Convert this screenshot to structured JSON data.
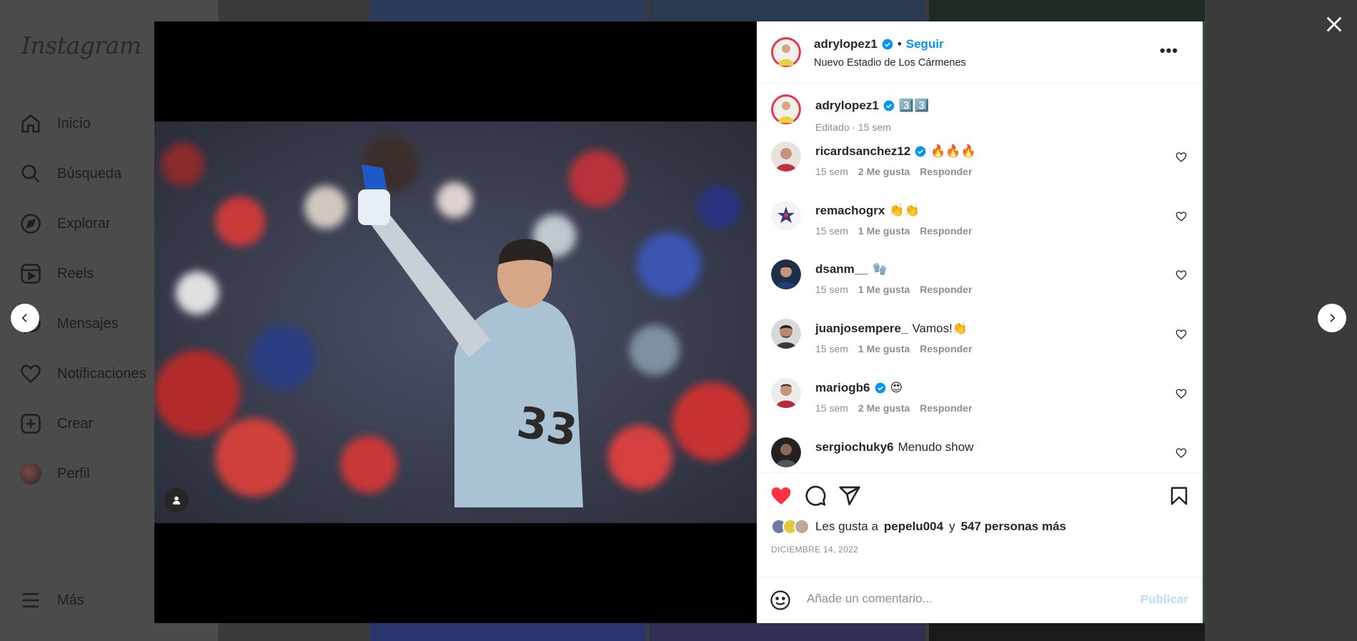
{
  "sidebar": {
    "logo": "Instagram",
    "items": [
      {
        "label": "Inicio",
        "icon": "home-icon"
      },
      {
        "label": "Búsqueda",
        "icon": "search-icon"
      },
      {
        "label": "Explorar",
        "icon": "compass-icon"
      },
      {
        "label": "Reels",
        "icon": "reels-icon"
      },
      {
        "label": "Mensajes",
        "icon": "messenger-icon"
      },
      {
        "label": "Notificaciones",
        "icon": "heart-icon"
      },
      {
        "label": "Crear",
        "icon": "plus-square-icon"
      },
      {
        "label": "Perfil",
        "icon": "profile-avatar"
      }
    ],
    "more": "Más"
  },
  "post": {
    "header": {
      "username": "adrylopez1",
      "separator": "•",
      "follow": "Seguir",
      "location": "Nuevo Estadio de Los Cármenes"
    },
    "caption": {
      "username": "adrylopez1",
      "text": "3️⃣3️⃣",
      "meta": "Editado · 15 sem"
    },
    "comments": [
      {
        "username": "ricardsanchez12",
        "verified": true,
        "text": "🔥🔥🔥",
        "time": "15 sem",
        "likes": "2 Me gusta",
        "reply": "Responder"
      },
      {
        "username": "remachogrx",
        "verified": false,
        "text": "👏👏",
        "time": "15 sem",
        "likes": "1 Me gusta",
        "reply": "Responder"
      },
      {
        "username": "dsanm__",
        "verified": false,
        "text": "🧤",
        "time": "15 sem",
        "likes": "1 Me gusta",
        "reply": "Responder"
      },
      {
        "username": "juanjosempere_",
        "verified": false,
        "text": "Vamos!👏",
        "time": "15 sem",
        "likes": "1 Me gusta",
        "reply": "Responder"
      },
      {
        "username": "mariogb6",
        "verified": true,
        "text": "😍",
        "time": "15 sem",
        "likes": "2 Me gusta",
        "reply": "Responder"
      },
      {
        "username": "sergiochuky6",
        "verified": false,
        "text": "Menudo show",
        "time": "",
        "likes": "",
        "reply": ""
      }
    ],
    "likes": {
      "prefix": "Les gusta a",
      "user": "pepelu004",
      "and": "y",
      "others": "547 personas más"
    },
    "date": "DICIEMBRE 14, 2022",
    "comment_placeholder": "Añade un comentario...",
    "publish": "Publicar"
  },
  "colors": {
    "accent": "#0095f6",
    "like": "#ff3040",
    "muted": "#8e8e8e"
  }
}
